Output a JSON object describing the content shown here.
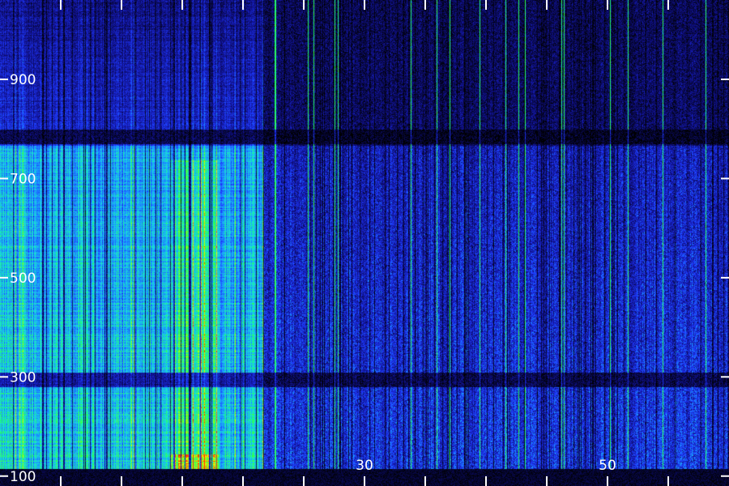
{
  "chart_data": {
    "type": "heatmap",
    "title": "",
    "xlabel": "",
    "ylabel": "",
    "y_ticks": [
      {
        "value": 100,
        "label": "100"
      },
      {
        "value": 300,
        "label": "300"
      },
      {
        "value": 500,
        "label": "500"
      },
      {
        "value": 700,
        "label": "700"
      },
      {
        "value": 900,
        "label": "900"
      }
    ],
    "x_ticks": [
      {
        "value": 30,
        "label": "30"
      },
      {
        "value": 50,
        "label": "50"
      }
    ],
    "ylim": [
      80,
      1060
    ],
    "xlim": [
      0,
      60
    ],
    "colormap": [
      "#000000",
      "#10108a",
      "#1f3aff",
      "#1aa0ff",
      "#19e6d0",
      "#22ff55",
      "#9aff10",
      "#ffee00",
      "#ff3300"
    ],
    "segments": [
      {
        "x_start": 0,
        "x_end": 21.6,
        "intensity": "high",
        "peak_band": [
          400,
          640
        ],
        "peak_x": [
          14,
          18
        ]
      },
      {
        "x_start": 21.6,
        "x_end": 60,
        "intensity": "low"
      }
    ],
    "dark_bands_y": [
      [
        280,
        310
      ],
      [
        770,
        800
      ]
    ]
  }
}
